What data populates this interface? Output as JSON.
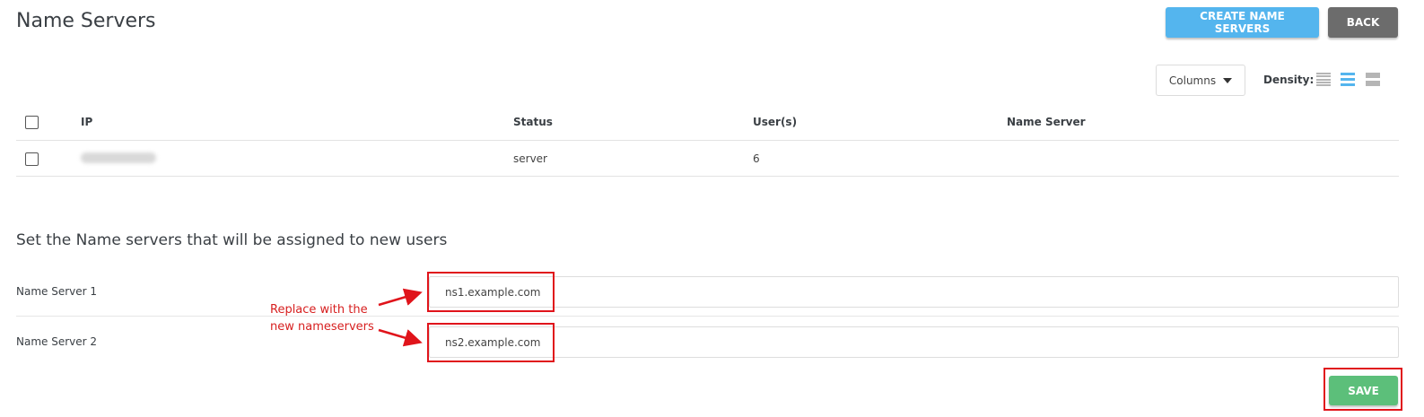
{
  "header": {
    "title": "Name Servers",
    "create_label": "CREATE NAME SERVERS",
    "back_label": "BACK"
  },
  "toolbar": {
    "columns_label": "Columns",
    "density_label": "Density:",
    "density_selected": "medium"
  },
  "table": {
    "columns": [
      "IP",
      "Status",
      "User(s)",
      "Name Server"
    ],
    "rows": [
      {
        "ip": "",
        "status": "server",
        "users": "6",
        "name_server": ""
      }
    ]
  },
  "settings": {
    "title": "Set the Name servers that will be assigned to new users",
    "ns1_label": "Name Server 1",
    "ns1_value": "ns1.example.com",
    "ns2_label": "Name Server 2",
    "ns2_value": "ns2.example.com",
    "save_label": "SAVE"
  },
  "annotation": {
    "line1": "Replace with the",
    "line2": "new nameservers"
  },
  "colors": {
    "primary": "#54b5ee",
    "secondary": "#6c6c6c",
    "success": "#5cbf7a",
    "annotation_red": "#e0141b"
  }
}
